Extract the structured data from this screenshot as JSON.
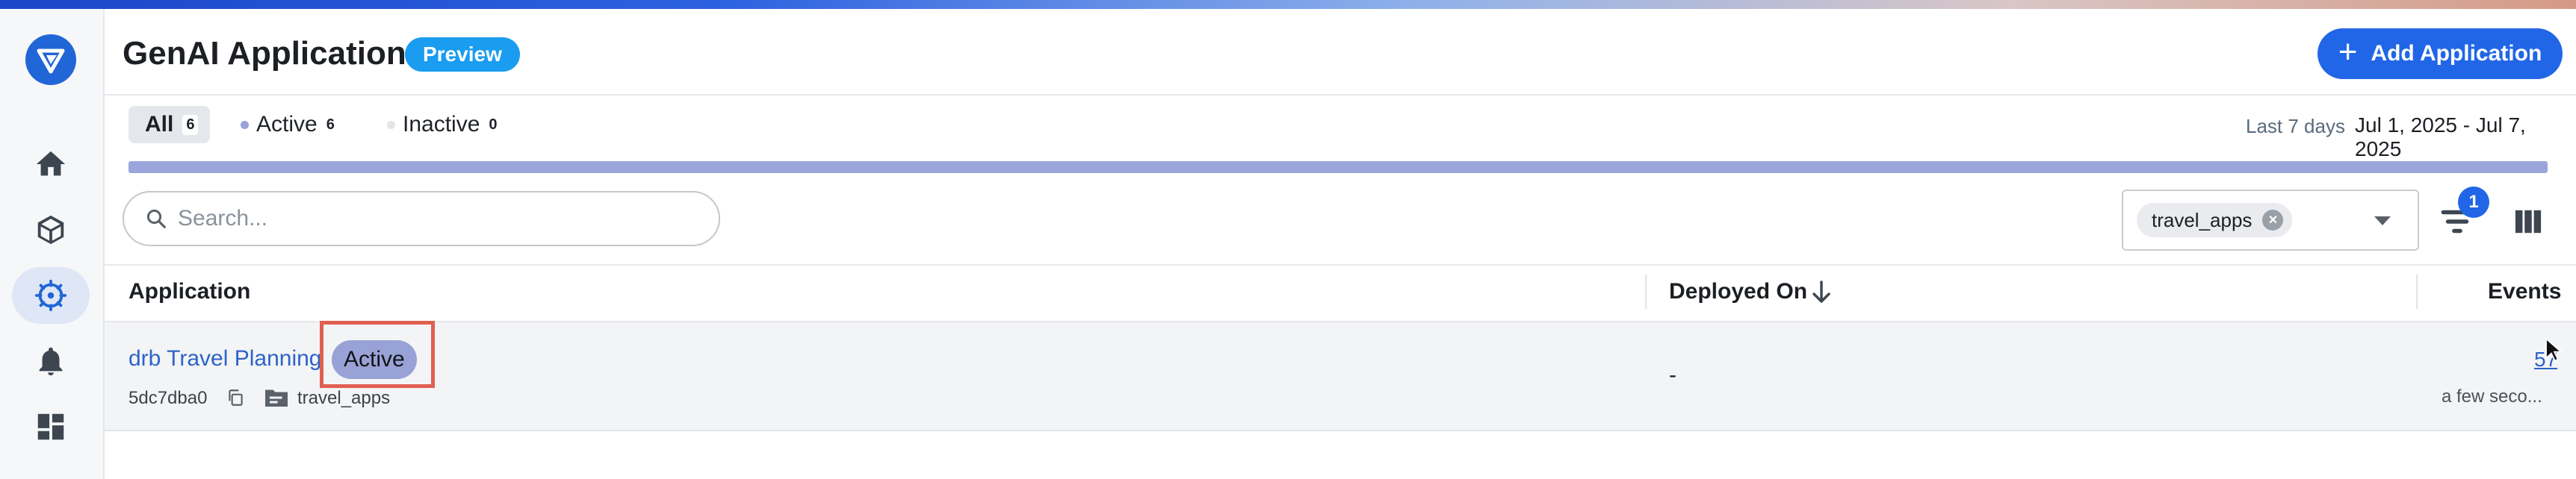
{
  "header": {
    "title": "GenAI Applications",
    "badge": "Preview",
    "add_button_label": "Add Application"
  },
  "sidebar": {
    "logo": "logo-icon",
    "items": [
      {
        "icon": "home-icon",
        "active": false
      },
      {
        "icon": "cube-icon",
        "active": false
      },
      {
        "icon": "brain-icon",
        "active": true
      },
      {
        "icon": "bell-icon",
        "active": false
      },
      {
        "icon": "dashboard-icon",
        "active": false
      }
    ]
  },
  "tabs": [
    {
      "label": "All",
      "count": "6",
      "selected": true
    },
    {
      "label": "Active",
      "count": "6",
      "selected": false
    },
    {
      "label": "Inactive",
      "count": "0",
      "selected": false
    }
  ],
  "date_range": {
    "label": "Last 7 days",
    "value": "Jul 1, 2025 - Jul 7, 2025"
  },
  "progress": {
    "active_fraction": 1.0
  },
  "search": {
    "placeholder": "Search..."
  },
  "filters": {
    "tag_chip": "travel_apps",
    "active_filter_count": "1"
  },
  "table": {
    "columns": [
      "Application",
      "Deployed On",
      "Events"
    ],
    "rows": [
      {
        "name": "drb Travel Planning",
        "status": "Active",
        "id": "5dc7dba0",
        "folder": "travel_apps",
        "deployed_on": "-",
        "events": "57",
        "events_time": "a few seco..."
      }
    ]
  },
  "colors": {
    "brand": "#2166e6",
    "preview_badge": "#1a9df0",
    "status_active": "#98a2d6",
    "link": "#2c63c8",
    "highlight": "#e06050"
  }
}
